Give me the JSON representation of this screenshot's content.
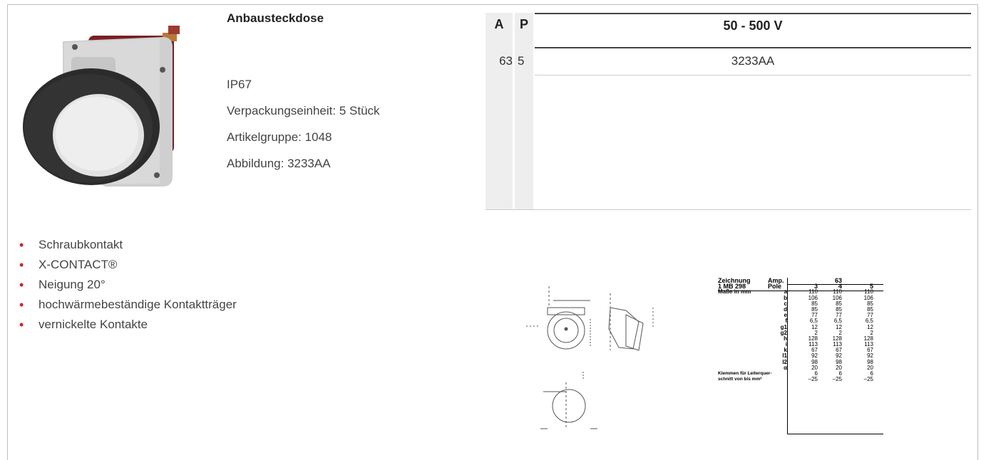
{
  "product": {
    "title": "Anbausteckdose",
    "properties": [
      "IP67",
      "Verpackungseinheit: 5 Stück",
      "Artikelgruppe: 1048",
      "Abbildung: 3233AA"
    ]
  },
  "spec_table": {
    "headers": {
      "a": "A",
      "p": "P",
      "voltage": "50 - 500 V"
    },
    "rows": [
      {
        "a": "63",
        "p": "5",
        "article": "3233AA"
      }
    ]
  },
  "features": [
    "Schraubkontakt",
    "X-CONTACT®",
    "Neigung 20°",
    "hochwärmebeständige Kontaktträger",
    "vernickelte Kontakte"
  ],
  "dimensions": {
    "drawing_label": "Zeichnung",
    "drawing_id": "1 MB 298",
    "amp_label": "Amp.",
    "amp_value": "63",
    "pole_label": "Pole",
    "poles": [
      "3",
      "4",
      "5"
    ],
    "unit_label": "Maße in mm",
    "rows": [
      {
        "key": "a",
        "values": [
          "110",
          "110",
          "110"
        ]
      },
      {
        "key": "b",
        "values": [
          "106",
          "106",
          "106"
        ]
      },
      {
        "key": "c",
        "values": [
          "85",
          "85",
          "85"
        ]
      },
      {
        "key": "d",
        "values": [
          "85",
          "85",
          "85"
        ]
      },
      {
        "key": "e",
        "values": [
          "77",
          "77",
          "77"
        ]
      },
      {
        "key": "f",
        "values": [
          "6,5",
          "6,5",
          "6,5"
        ]
      },
      {
        "key": "g1",
        "values": [
          "12",
          "12",
          "12"
        ]
      },
      {
        "key": "g2",
        "values": [
          "2",
          "2",
          "2"
        ]
      },
      {
        "key": "h",
        "values": [
          "128",
          "128",
          "128"
        ]
      },
      {
        "key": "i",
        "values": [
          "113",
          "113",
          "113"
        ]
      },
      {
        "key": "k",
        "values": [
          "67",
          "67",
          "67"
        ]
      },
      {
        "key": "l1",
        "values": [
          "92",
          "92",
          "92"
        ]
      },
      {
        "key": "l2",
        "values": [
          "98",
          "98",
          "98"
        ]
      },
      {
        "key": "α",
        "values": [
          "20",
          "20",
          "20"
        ]
      }
    ],
    "clamp_label_1": "Klemmen für Leiterquer-",
    "clamp_label_2": "schnitt von bis mm²",
    "clamp_from": [
      "6",
      "6",
      "6"
    ],
    "clamp_to": [
      "–25",
      "–25",
      "–25"
    ]
  },
  "colors": {
    "bullet": "#d2232a",
    "column_bg": "#eeeeee",
    "rule": "#444444"
  }
}
